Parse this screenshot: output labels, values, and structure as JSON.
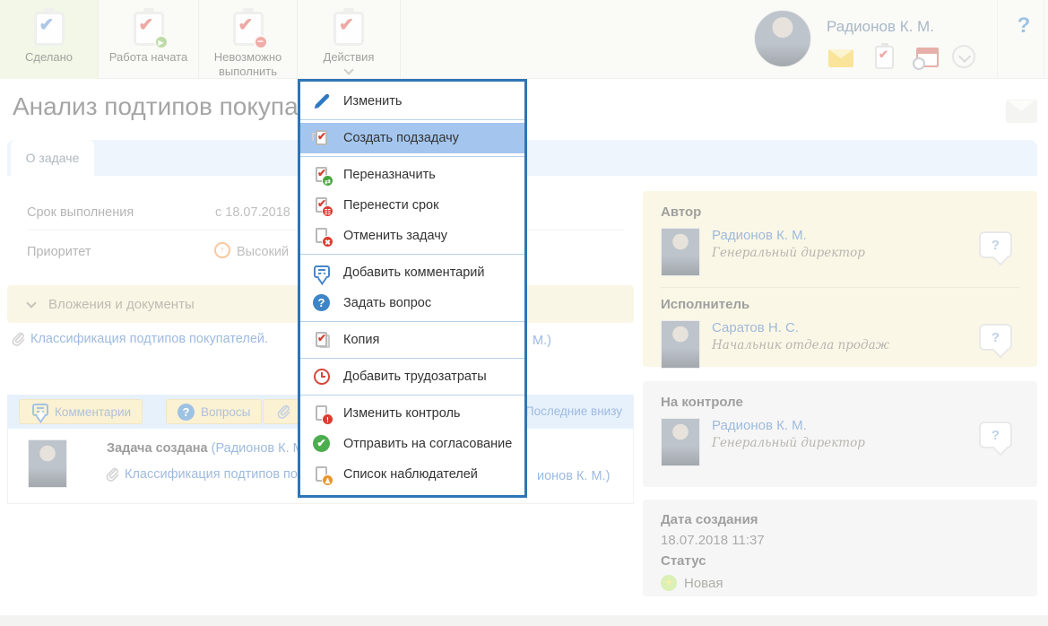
{
  "header": {
    "buttons": [
      {
        "label": "Сделано",
        "icon": "clipboard-blue-check-icon"
      },
      {
        "label": "Работа начата",
        "icon": "clipboard-check-play-icon"
      },
      {
        "label": "Невозможно выполнить",
        "icon": "clipboard-check-minus-icon"
      },
      {
        "label": "Действия",
        "icon": "clipboard-check-icon"
      }
    ],
    "user_name": "Радионов К. М.",
    "help_label": "?",
    "icons": [
      "mail-icon",
      "tasks-icon",
      "calendar-icon",
      "chevron-down-circle-icon"
    ]
  },
  "menu": {
    "items": [
      {
        "label": "Изменить",
        "icon": "pencil-icon"
      },
      {
        "label": "Создать подзадачу",
        "icon": "subtask-icon",
        "highlighted": true
      },
      {
        "label": "Переназначить",
        "icon": "reassign-icon"
      },
      {
        "label": "Перенести срок",
        "icon": "reschedule-icon"
      },
      {
        "label": "Отменить задачу",
        "icon": "cancel-task-icon"
      },
      {
        "label": "Добавить комментарий",
        "icon": "comment-icon"
      },
      {
        "label": "Задать вопрос",
        "icon": "question-icon"
      },
      {
        "label": "Копия",
        "icon": "copy-icon"
      },
      {
        "label": "Добавить трудозатраты",
        "icon": "clock-icon"
      },
      {
        "label": "Изменить контроль",
        "icon": "control-icon"
      },
      {
        "label": "Отправить на согласование",
        "icon": "approve-icon"
      },
      {
        "label": "Список наблюдателей",
        "icon": "observers-icon"
      }
    ]
  },
  "task": {
    "title": "Анализ подтипов покупат",
    "tab_label": "О задаче",
    "deadline_label": "Срок выполнения",
    "deadline_value": "с 18.07.2018",
    "priority_label": "Приоритет",
    "priority_value": "Высокий",
    "priority_icon": "priority-high-icon",
    "attachments_section": "Вложения и документы",
    "attachment_link": "Классификация подтипов покупателей.",
    "attachment_tail": "М.)"
  },
  "comments": {
    "tab_comments": "Комментарии",
    "tab_questions": "Вопросы",
    "sort_label": "Последние внизу",
    "entry_title": "Задача создана",
    "entry_author_fragment": "(Радионов К. М.",
    "entry_link_fragment": "Классификация подтипов поку",
    "entry_tail_fragment": "ионов К. М.)"
  },
  "sidebar": {
    "author_label": "Автор",
    "author_name": "Радионов К. М.",
    "author_role": "Генеральный директор",
    "executor_label": "Исполнитель",
    "executor_name": "Саратов Н. С.",
    "executor_role": "Начальник отдела продаж",
    "control_label": "На контроле",
    "control_name": "Радионов К. М.",
    "control_role": "Генеральный директор",
    "created_label": "Дата создания",
    "created_value": "18.07.2018 11:37",
    "status_label": "Статус",
    "status_value": "Новая",
    "bubble_label": "?"
  },
  "colors": {
    "menu_border": "#2e75b6",
    "menu_highlight": "#a4c6ee",
    "link_blue": "#3b74bd",
    "accent_green": "#4cae4f",
    "accent_red": "#d4483c",
    "cream_section": "#f5ecca",
    "status_green": "#b5e06b"
  }
}
